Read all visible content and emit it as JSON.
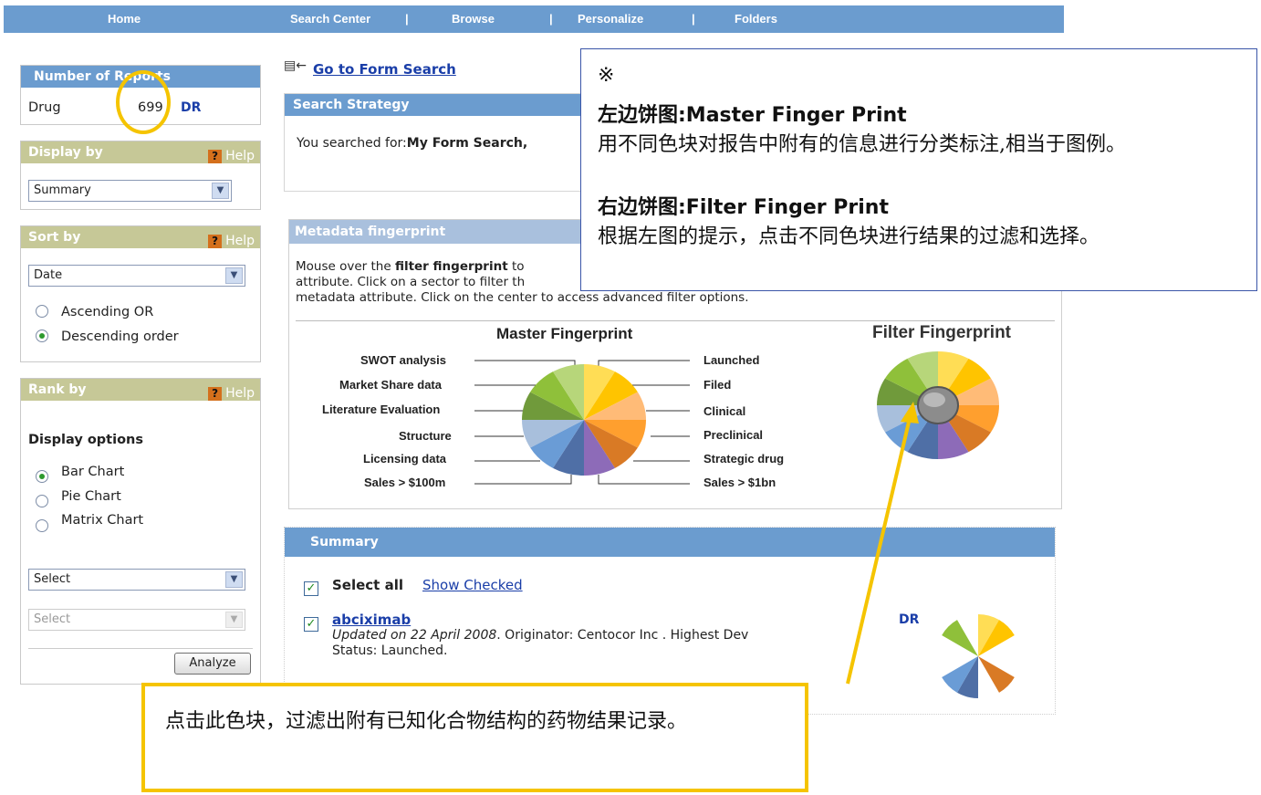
{
  "nav": {
    "items": [
      "Home",
      "Search Center",
      "Browse",
      "Personalize",
      "Folders"
    ],
    "separator": "|"
  },
  "reports": {
    "title": "Number of Reports",
    "label": "Drug",
    "count": "699",
    "badge": "DR"
  },
  "display_by": {
    "title": "Display by",
    "help": "Help",
    "help_icon": "?",
    "value": "Summary"
  },
  "sort_by": {
    "title": "Sort by",
    "help": "Help",
    "help_icon": "?",
    "value": "Date",
    "options": [
      "Ascending OR",
      "Descending order"
    ],
    "selected": 1
  },
  "rank_by": {
    "title": "Rank by",
    "help": "Help",
    "help_icon": "?",
    "display_options_title": "Display options",
    "options": [
      "Bar Chart",
      "Pie Chart",
      "Matrix Chart"
    ],
    "selected": 0,
    "select1": "Select",
    "select2": "Select",
    "analyze": "Analyze"
  },
  "form_search": {
    "link": "Go to Form Search"
  },
  "search_strategy": {
    "title": "Search Strategy",
    "prefix": "You searched for:",
    "query": "My Form Search,"
  },
  "metadata": {
    "title": "Metadata fingerprint",
    "desc_part1": "Mouse over the ",
    "desc_bold": "filter fingerprint",
    "desc_part2": " to",
    "line2": "attribute. Click on a sector to filter th",
    "line3": "metadata attribute. Click on the center to access advanced filter options."
  },
  "master_fp": {
    "title": "Master Fingerprint",
    "left_labels": [
      "SWOT analysis",
      "Market Share data",
      "Literature Evaluation",
      "Structure",
      "Licensing data",
      "Sales > $100m"
    ],
    "right_labels": [
      "Launched",
      "Filed",
      "Clinical",
      "Preclinical",
      "Strategic drug",
      "Sales > $1bn"
    ]
  },
  "filter_fp": {
    "title": "Filter Fingerprint"
  },
  "summary": {
    "title": "Summary",
    "select_all": "Select all",
    "show_checked": "Show Checked",
    "item": {
      "name": "abciximab",
      "updated": "Updated on 22 April 2008",
      "rest": ". Originator: Centocor Inc . Highest Dev",
      "status": "Status: Launched.",
      "badge": "DR"
    }
  },
  "note_box": {
    "mark": "※",
    "left_title": "左边饼图:Master Finger Print",
    "left_desc": "用不同色块对报告中附有的信息进行分类标注,相当于图例。",
    "right_title": "右边饼图:Filter Finger Print",
    "right_desc": "根据左图的提示，点击不同色块进行结果的过滤和选择。"
  },
  "callout": {
    "text": "点击此色块，过滤出附有已知化合物结构的药物结果记录。"
  },
  "colors": {
    "nav": "#6b9ccf",
    "panel_olive": "#c6c897",
    "highlight": "#f5c400",
    "note_border": "#3a55a8"
  }
}
